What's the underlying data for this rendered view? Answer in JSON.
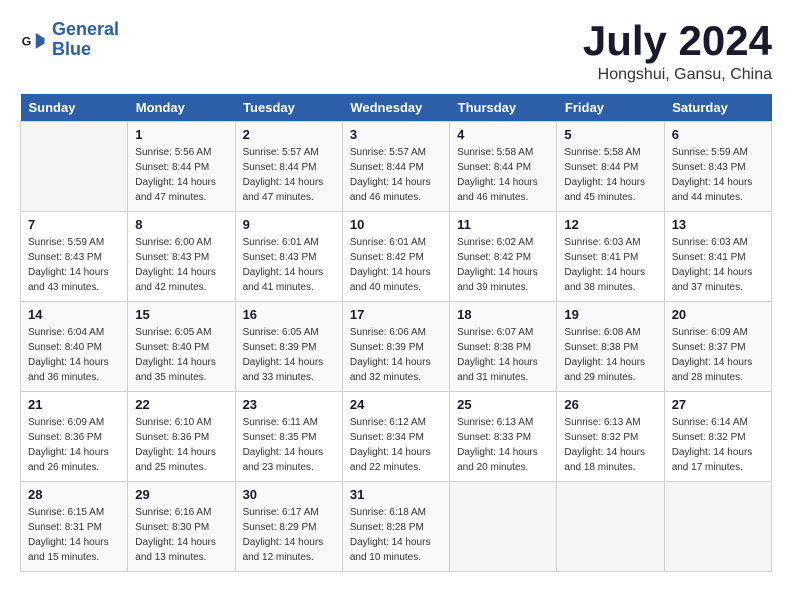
{
  "header": {
    "logo_line1": "General",
    "logo_line2": "Blue",
    "month_title": "July 2024",
    "location": "Hongshui, Gansu, China"
  },
  "columns": [
    "Sunday",
    "Monday",
    "Tuesday",
    "Wednesday",
    "Thursday",
    "Friday",
    "Saturday"
  ],
  "weeks": [
    {
      "days": [
        {
          "num": "",
          "empty": true
        },
        {
          "num": "1",
          "sunrise": "5:56 AM",
          "sunset": "8:44 PM",
          "daylight": "14 hours and 47 minutes."
        },
        {
          "num": "2",
          "sunrise": "5:57 AM",
          "sunset": "8:44 PM",
          "daylight": "14 hours and 47 minutes."
        },
        {
          "num": "3",
          "sunrise": "5:57 AM",
          "sunset": "8:44 PM",
          "daylight": "14 hours and 46 minutes."
        },
        {
          "num": "4",
          "sunrise": "5:58 AM",
          "sunset": "8:44 PM",
          "daylight": "14 hours and 46 minutes."
        },
        {
          "num": "5",
          "sunrise": "5:58 AM",
          "sunset": "8:44 PM",
          "daylight": "14 hours and 45 minutes."
        },
        {
          "num": "6",
          "sunrise": "5:59 AM",
          "sunset": "8:43 PM",
          "daylight": "14 hours and 44 minutes."
        }
      ]
    },
    {
      "days": [
        {
          "num": "7",
          "sunrise": "5:59 AM",
          "sunset": "8:43 PM",
          "daylight": "14 hours and 43 minutes."
        },
        {
          "num": "8",
          "sunrise": "6:00 AM",
          "sunset": "8:43 PM",
          "daylight": "14 hours and 42 minutes."
        },
        {
          "num": "9",
          "sunrise": "6:01 AM",
          "sunset": "8:43 PM",
          "daylight": "14 hours and 41 minutes."
        },
        {
          "num": "10",
          "sunrise": "6:01 AM",
          "sunset": "8:42 PM",
          "daylight": "14 hours and 40 minutes."
        },
        {
          "num": "11",
          "sunrise": "6:02 AM",
          "sunset": "8:42 PM",
          "daylight": "14 hours and 39 minutes."
        },
        {
          "num": "12",
          "sunrise": "6:03 AM",
          "sunset": "8:41 PM",
          "daylight": "14 hours and 38 minutes."
        },
        {
          "num": "13",
          "sunrise": "6:03 AM",
          "sunset": "8:41 PM",
          "daylight": "14 hours and 37 minutes."
        }
      ]
    },
    {
      "days": [
        {
          "num": "14",
          "sunrise": "6:04 AM",
          "sunset": "8:40 PM",
          "daylight": "14 hours and 36 minutes."
        },
        {
          "num": "15",
          "sunrise": "6:05 AM",
          "sunset": "8:40 PM",
          "daylight": "14 hours and 35 minutes."
        },
        {
          "num": "16",
          "sunrise": "6:05 AM",
          "sunset": "8:39 PM",
          "daylight": "14 hours and 33 minutes."
        },
        {
          "num": "17",
          "sunrise": "6:06 AM",
          "sunset": "8:39 PM",
          "daylight": "14 hours and 32 minutes."
        },
        {
          "num": "18",
          "sunrise": "6:07 AM",
          "sunset": "8:38 PM",
          "daylight": "14 hours and 31 minutes."
        },
        {
          "num": "19",
          "sunrise": "6:08 AM",
          "sunset": "8:38 PM",
          "daylight": "14 hours and 29 minutes."
        },
        {
          "num": "20",
          "sunrise": "6:09 AM",
          "sunset": "8:37 PM",
          "daylight": "14 hours and 28 minutes."
        }
      ]
    },
    {
      "days": [
        {
          "num": "21",
          "sunrise": "6:09 AM",
          "sunset": "8:36 PM",
          "daylight": "14 hours and 26 minutes."
        },
        {
          "num": "22",
          "sunrise": "6:10 AM",
          "sunset": "8:36 PM",
          "daylight": "14 hours and 25 minutes."
        },
        {
          "num": "23",
          "sunrise": "6:11 AM",
          "sunset": "8:35 PM",
          "daylight": "14 hours and 23 minutes."
        },
        {
          "num": "24",
          "sunrise": "6:12 AM",
          "sunset": "8:34 PM",
          "daylight": "14 hours and 22 minutes."
        },
        {
          "num": "25",
          "sunrise": "6:13 AM",
          "sunset": "8:33 PM",
          "daylight": "14 hours and 20 minutes."
        },
        {
          "num": "26",
          "sunrise": "6:13 AM",
          "sunset": "8:32 PM",
          "daylight": "14 hours and 18 minutes."
        },
        {
          "num": "27",
          "sunrise": "6:14 AM",
          "sunset": "8:32 PM",
          "daylight": "14 hours and 17 minutes."
        }
      ]
    },
    {
      "days": [
        {
          "num": "28",
          "sunrise": "6:15 AM",
          "sunset": "8:31 PM",
          "daylight": "14 hours and 15 minutes."
        },
        {
          "num": "29",
          "sunrise": "6:16 AM",
          "sunset": "8:30 PM",
          "daylight": "14 hours and 13 minutes."
        },
        {
          "num": "30",
          "sunrise": "6:17 AM",
          "sunset": "8:29 PM",
          "daylight": "14 hours and 12 minutes."
        },
        {
          "num": "31",
          "sunrise": "6:18 AM",
          "sunset": "8:28 PM",
          "daylight": "14 hours and 10 minutes."
        },
        {
          "num": "",
          "empty": true
        },
        {
          "num": "",
          "empty": true
        },
        {
          "num": "",
          "empty": true
        }
      ]
    }
  ]
}
